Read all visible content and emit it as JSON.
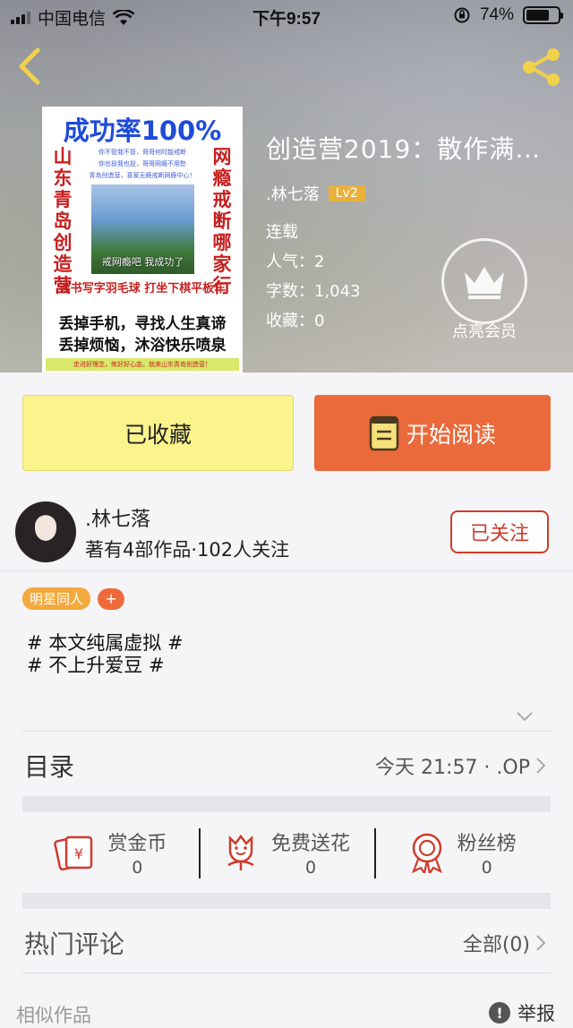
{
  "status_bar": {
    "carrier": "中国电信",
    "time": "下午9:57",
    "battery": "74%",
    "battery_level": 0.74
  },
  "cover": {
    "headline": "成功率100%",
    "left_vertical": "山东青岛创造营",
    "right_vertical": "网瘾戒断哪家行",
    "small_lines": [
      "你不管我不管，哥哥何时能戒断",
      "你也投我也投，哥哥网瘾不用愁",
      "青岛创造营，喜家无瘾戒断网瘾中心！"
    ],
    "photo_caption": "戒网瘾吧 我成功了",
    "middle": "读书写字羽毛球  打坐下棋平板车",
    "line1": "丢掉手机，寻找人生真谛",
    "line2": "丢掉烦恼，沐浴快乐喷泉",
    "footer": "走进好理念，练好好心态，就来山东青岛创造营！"
  },
  "book": {
    "title": "创造营2019：散作满…",
    "author": ".林七落",
    "level": "Lv2",
    "status": "连载",
    "popularity": "人气：2",
    "word_count": "字数：1,043",
    "favorites": "收藏：0"
  },
  "vip": {
    "label": "点亮会员"
  },
  "buttons": {
    "favorite": "已收藏",
    "read": "开始阅读"
  },
  "author": {
    "name": ".林七落",
    "stats": "著有4部作品·102人关注",
    "follow": "已关注"
  },
  "tags": {
    "category": "明星同人",
    "add": "+"
  },
  "description": [
    "# 本文纯属虚拟 #",
    "# 不上升爱豆 #"
  ],
  "toc": {
    "label": "目录",
    "latest": "今天 21:57 · .OP"
  },
  "actions": [
    {
      "label": "赏金币",
      "count": "0",
      "icon": "red-envelope-yen-icon"
    },
    {
      "label": "免费送花",
      "count": "0",
      "icon": "flower-icon"
    },
    {
      "label": "粉丝榜",
      "count": "0",
      "icon": "medal-icon"
    }
  ],
  "comments": {
    "label": "热门评论",
    "all": "全部(0)"
  },
  "footer": {
    "similar": "相似作品",
    "report": "举报"
  },
  "colors": {
    "accent_orange": "#ea6a3b",
    "fav_yellow": "#fbf38b",
    "tag_orange": "#f4a93d",
    "follow_red": "#d03a2a"
  }
}
